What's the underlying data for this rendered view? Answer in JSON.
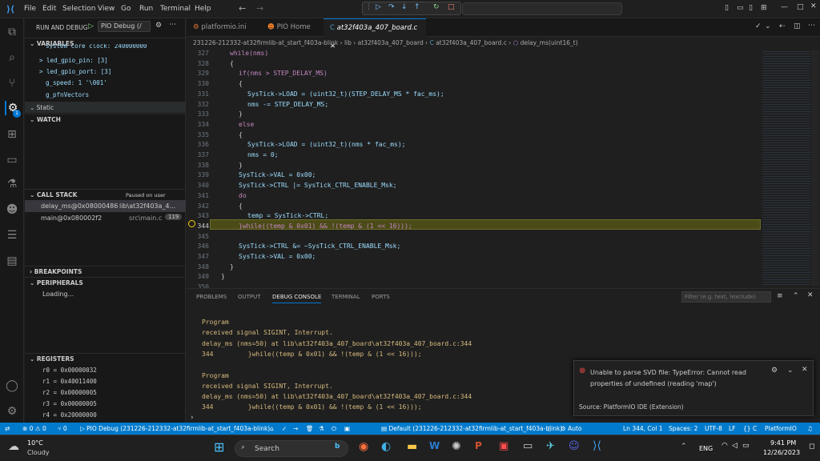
{
  "titlebar": {
    "menus": [
      "File",
      "Edit",
      "Selection",
      "View",
      "Go",
      "Run",
      "Terminal",
      "Help"
    ]
  },
  "sidebar": {
    "header": "RUN AND DEBUG",
    "config": "PIO Debug (/",
    "variables_title": "VARIABLES",
    "variables": [
      "system_core_clock: 240000000",
      "> led_gpio_pin: [3]",
      "> led_gpio_port: [3]",
      "g_speed: 1 '\\001'",
      "g_pfnVectors"
    ],
    "static_title": "Static",
    "watch_title": "WATCH",
    "callstack_title": "CALL STACK",
    "callstack_status": "Paused on user request",
    "frames": [
      {
        "fn": "delay_ms@0x08000486",
        "file": "lib\\at32f403a_4..."
      },
      {
        "fn": "main@0x080002f2",
        "file": "src\\main.c",
        "badge": "119"
      }
    ],
    "breakpoints_title": "BREAKPOINTS",
    "peripherals_title": "PERIPHERALS",
    "peripherals_loading": "Loading...",
    "registers_title": "REGISTERS",
    "registers": [
      "r0 = 0x00000032",
      "r1 = 0x40011400",
      "r2 = 0x00000005",
      "r3 = 0x00000005",
      "r4 = 0x20000000"
    ]
  },
  "tabs": [
    "platformio.ini",
    "PIO Home",
    "at32f403a_407_board.c"
  ],
  "breadcrumb": [
    "231226-212332-at32firmlib-at_start_f403a-blink",
    "lib",
    "at32f403a_407_board",
    "at32f403a_407_board.c",
    "delay_ms(uint16_t)"
  ],
  "code": {
    "lines": [
      "327",
      "328",
      "329",
      "330",
      "331",
      "332",
      "333",
      "334",
      "335",
      "336",
      "337",
      "338",
      "339",
      "340",
      "341",
      "342",
      "343",
      "344",
      "345",
      "346",
      "347",
      "348",
      "349",
      "350"
    ],
    "text": [
      "while(nms)",
      "{",
      "if(nms > STEP_DELAY_MS)",
      "{",
      "SysTick->LOAD = (uint32_t)(STEP_DELAY_MS * fac_ms);",
      "nms -= STEP_DELAY_MS;",
      "}",
      "else",
      "{",
      "SysTick->LOAD = (uint32_t)(nms * fac_ms);",
      "nms = 0;",
      "}",
      "SysTick->VAL = 0x00;",
      "SysTick->CTRL |= SysTick_CTRL_ENABLE_Msk;",
      "do",
      "{",
      "temp = SysTick->CTRL;",
      "}while((temp & 0x01) && !(temp & (1 << 16)));",
      "",
      "SysTick->CTRL &= ~SysTick_CTRL_ENABLE_Msk;",
      "SysTick->VAL = 0x00;",
      "}",
      "}",
      ""
    ]
  },
  "panel": {
    "tabs": [
      "PROBLEMS",
      "OUTPUT",
      "DEBUG CONSOLE",
      "TERMINAL",
      "PORTS"
    ],
    "filter_placeholder": "Filter (e.g. text, !exclude)",
    "console": [
      "Program",
      "received signal SIGINT, Interrupt.",
      "delay_ms (nms=50) at lib\\at32f403a_407_board\\at32f403a_407_board.c:344",
      "344         }while((temp & 0x01) && !(temp & (1 << 16)));",
      "",
      "Program",
      "received signal SIGINT, Interrupt.",
      "delay_ms (nms=50) at lib\\at32f403a_407_board\\at32f403a_407_board.c:344",
      "344         }while((temp & 0x01) && !(temp & (1 << 16)));"
    ]
  },
  "notification": {
    "text1": "Unable to parse SVD file: TypeError: Cannot read",
    "text2": "properties of undefined (reading 'map')",
    "source": "Source: PlatformIO IDE (Extension)"
  },
  "status": {
    "errors": "0",
    "warnings": "0",
    "debug": "PIO Debug (231226-212332-at32firmlib-at_start_f403a-blink)",
    "default": "Default (231226-212332-at32firmlib-at_start_f403a-blink)",
    "auto": "Auto",
    "pos": "Ln 344, Col 1",
    "spaces": "Spaces: 2",
    "enc": "UTF-8",
    "eol": "LF",
    "lang": "C",
    "pio": "PlatformIO"
  },
  "taskbar": {
    "temp": "10°C",
    "weather": "Cloudy",
    "search": "Search",
    "lang": "ENG",
    "time": "9:41 PM",
    "date": "12/26/2023"
  }
}
